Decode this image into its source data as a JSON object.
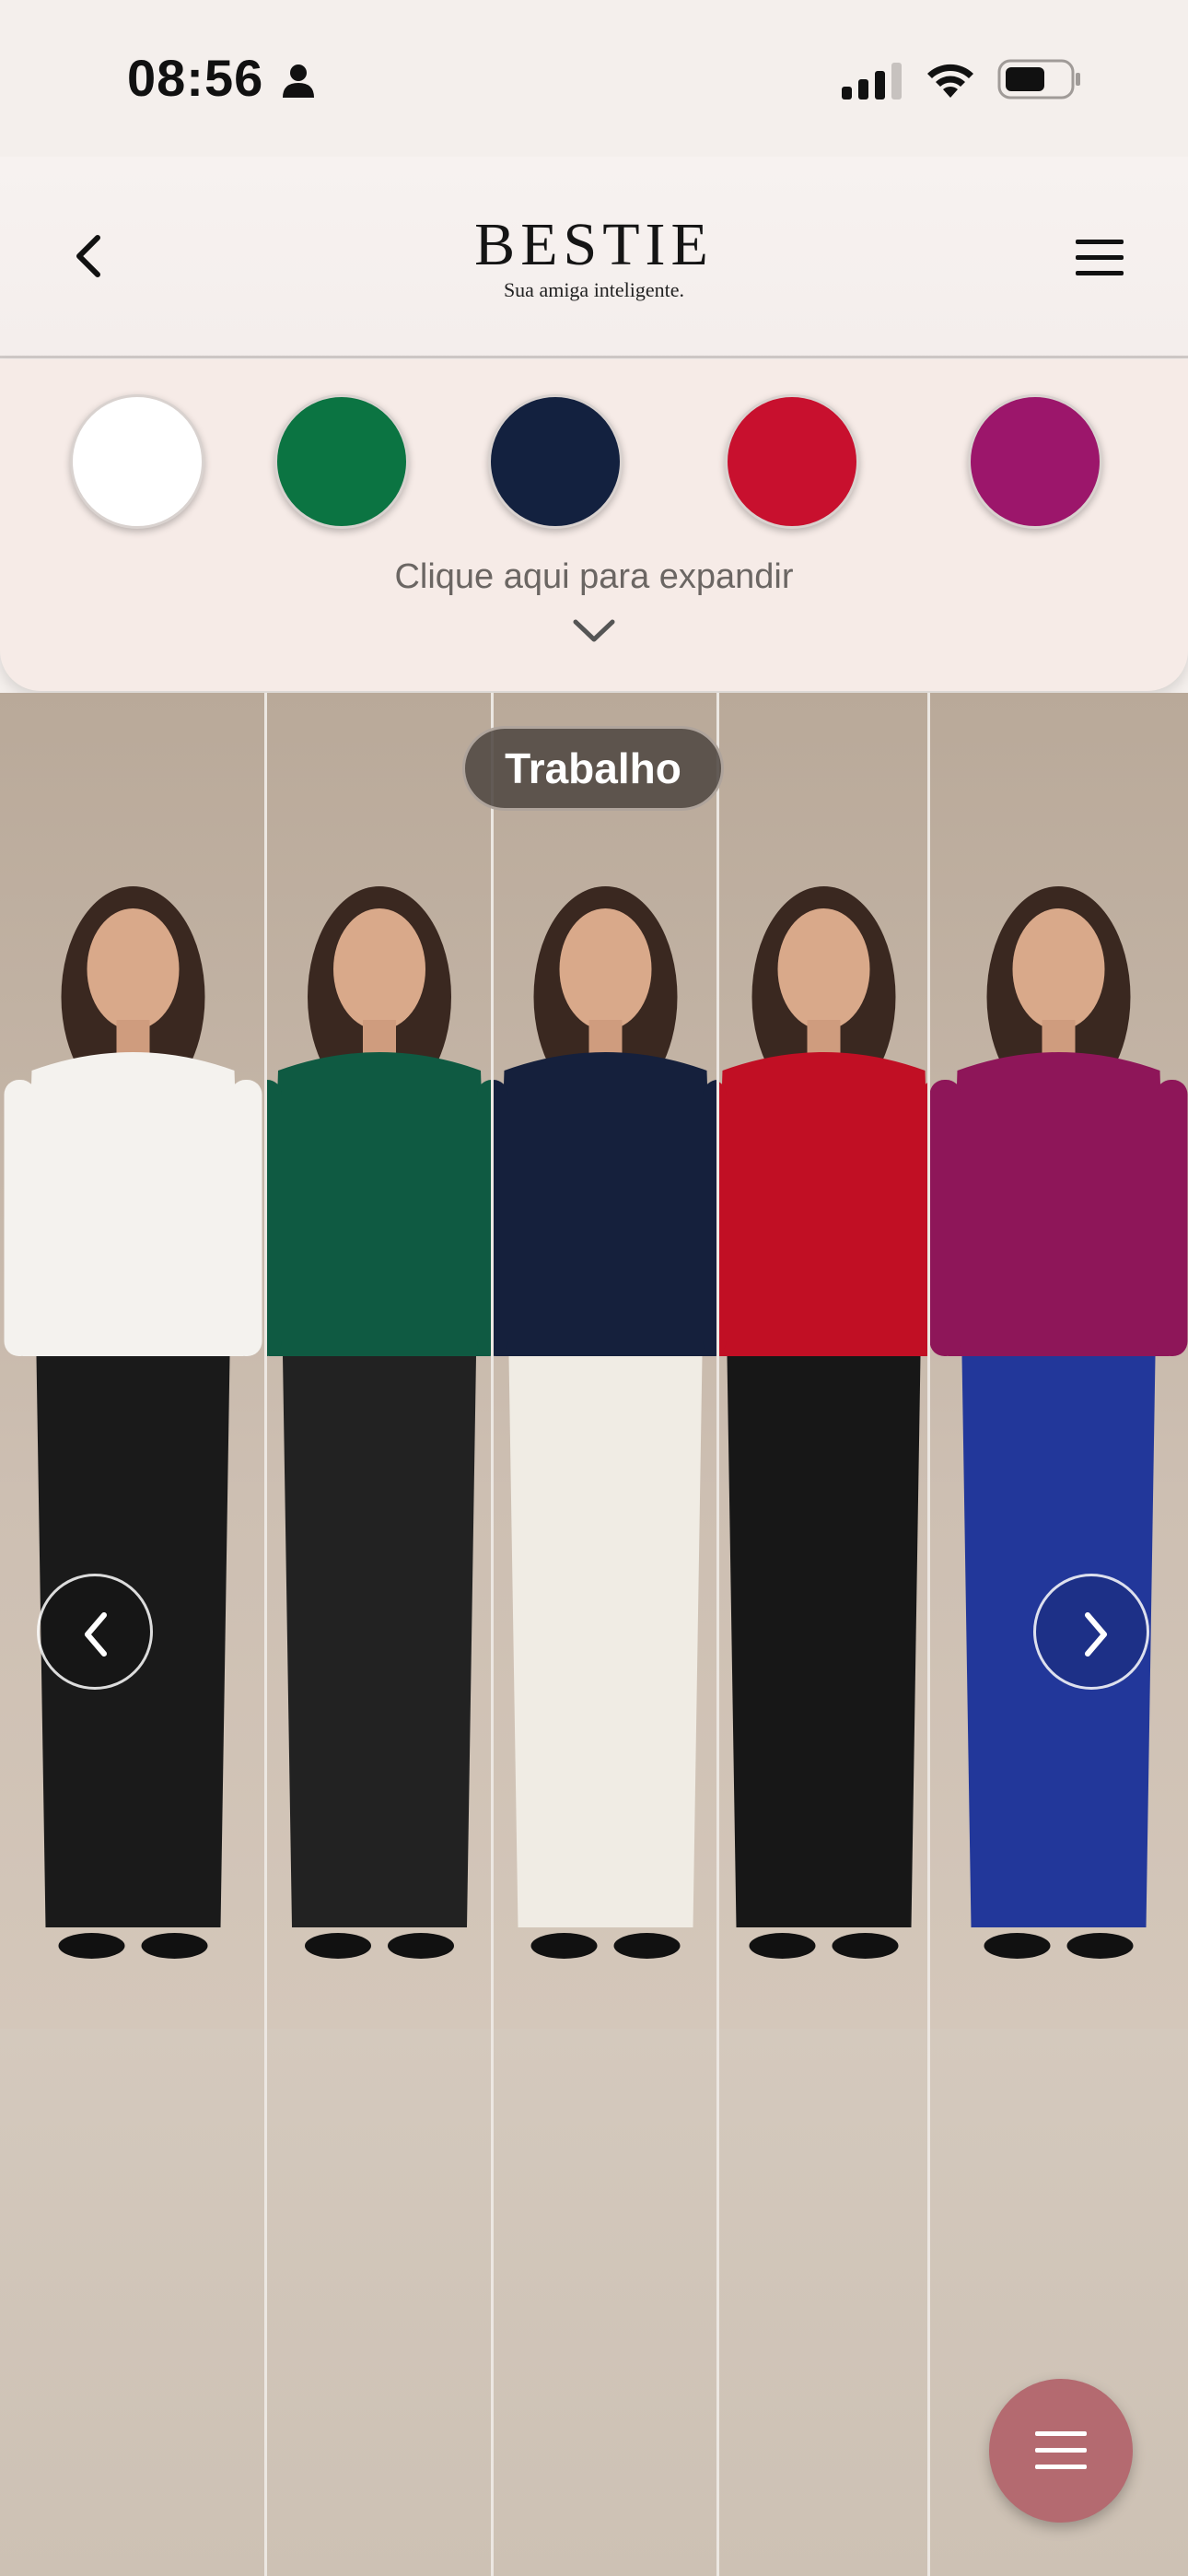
{
  "status_bar": {
    "time": "08:56"
  },
  "header": {
    "brand": "BESTIE",
    "tagline": "Sua amiga inteligente."
  },
  "color_panel": {
    "swatches": [
      {
        "name": "branco",
        "color": "#ffffff"
      },
      {
        "name": "verde",
        "color": "#0b7442"
      },
      {
        "name": "azul-marinho",
        "color": "#13213f"
      },
      {
        "name": "vermelho",
        "color": "#c8102e"
      },
      {
        "name": "magenta",
        "color": "#9c166b"
      }
    ],
    "expand_label": "Clique aqui para expandir"
  },
  "gallery": {
    "category": "Trabalho",
    "looks": [
      {
        "top": "white blouse",
        "top_color": "#f4f2ee",
        "bottom": "black trousers",
        "bottom_color": "#1a1a1a"
      },
      {
        "top": "green satin blouse",
        "top_color": "#0f5a42",
        "bottom": "black pencil skirt",
        "bottom_color": "#222222"
      },
      {
        "top": "navy blazer",
        "top_color": "#15203c",
        "bottom": "white trousers",
        "bottom_color": "#f0ece4"
      },
      {
        "top": "red turtleneck",
        "top_color": "#c10f24",
        "bottom": "black trousers",
        "bottom_color": "#171717"
      },
      {
        "top": "magenta satin top",
        "top_color": "#8e1659",
        "bottom": "blue midi skirt",
        "bottom_color": "#22379a"
      }
    ]
  },
  "colors": {
    "fab": "#b46a70",
    "pill": "#504842"
  }
}
